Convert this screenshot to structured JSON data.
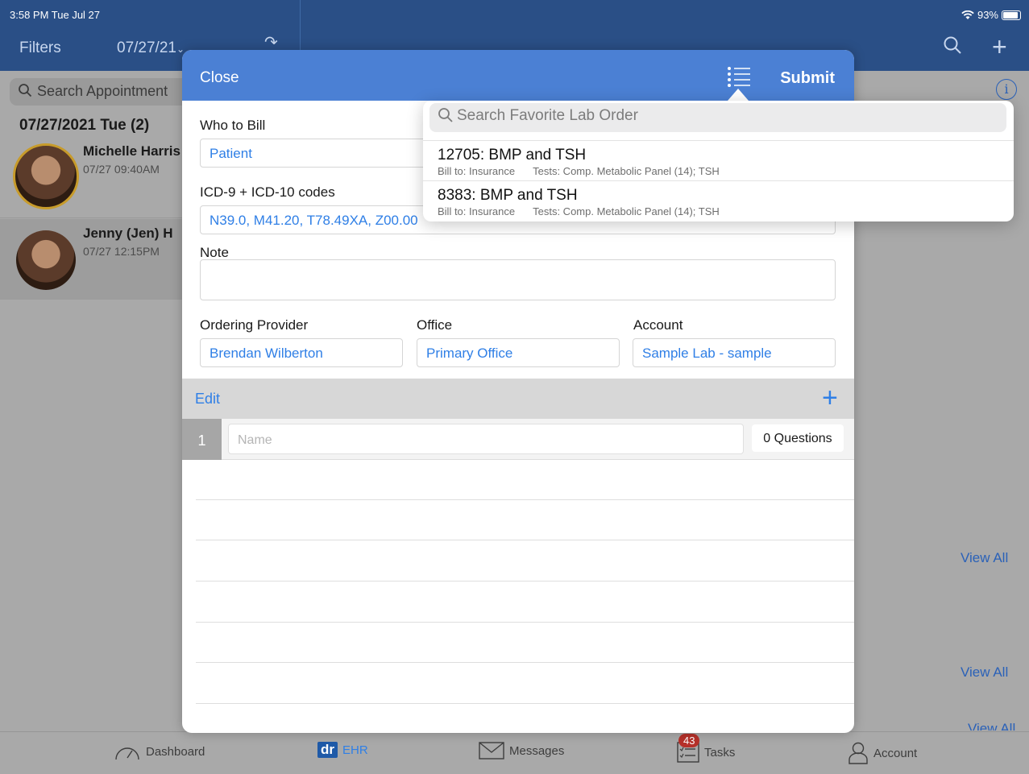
{
  "status_bar": {
    "time": "3:58 PM  Tue Jul 27",
    "wifi_icon": "wifi-icon",
    "battery": "93%"
  },
  "app_header": {
    "filters_label": "Filters",
    "date": "07/27/21",
    "search_icon": "search-icon",
    "add_icon": "plus-icon"
  },
  "appointments": {
    "search_placeholder": "Search Appointment",
    "day_header": "07/27/2021 Tue (2)",
    "items": [
      {
        "name": "Michelle Harris",
        "time": "07/27 09:40AM"
      },
      {
        "name": "Jenny (Jen) H",
        "time": "07/27 12:15PM"
      }
    ]
  },
  "right_pane": {
    "view_all_labels": [
      "View All",
      "View All",
      "View All"
    ]
  },
  "modal": {
    "close_label": "Close",
    "submit_label": "Submit",
    "who_to_bill": {
      "label": "Who to Bill",
      "value": "Patient"
    },
    "icd_codes": {
      "label": "ICD-9 + ICD-10 codes",
      "value": "N39.0, M41.20, T78.49XA, Z00.00"
    },
    "note": {
      "label": "Note",
      "value": ""
    },
    "ordering_provider": {
      "label": "Ordering Provider",
      "value": "Brendan Wilberton"
    },
    "office": {
      "label": "Office",
      "value": "Primary Office"
    },
    "account": {
      "label": "Account",
      "value": "Sample Lab - sample"
    },
    "edit_label": "Edit",
    "question_row": {
      "number": "1",
      "name_placeholder": "Name",
      "questions": "0 Questions"
    }
  },
  "favorites": {
    "search_placeholder": "Search Favorite Lab Order",
    "items": [
      {
        "title": "12705: BMP and TSH",
        "bill_to": "Bill to: Insurance",
        "tests": "Tests: Comp. Metabolic Panel (14); TSH"
      },
      {
        "title": "8383: BMP and TSH",
        "bill_to": "Bill to: Insurance",
        "tests": "Tests: Comp. Metabolic Panel (14); TSH"
      }
    ]
  },
  "tab_bar": {
    "items": [
      {
        "label": "Dashboard",
        "icon": "dashboard-gauge-icon"
      },
      {
        "label": "EHR",
        "icon": "dr",
        "selected": true
      },
      {
        "label": "Messages",
        "icon": "envelope-icon"
      },
      {
        "label": "Tasks",
        "icon": "checklist-icon",
        "badge": "43"
      },
      {
        "label": "Account",
        "icon": "account-icon"
      }
    ]
  },
  "colors": {
    "header_blue": "#2a4f86",
    "modal_header": "#4b80d4",
    "link_blue": "#2f7fe6",
    "badge_red": "#b6312a"
  }
}
